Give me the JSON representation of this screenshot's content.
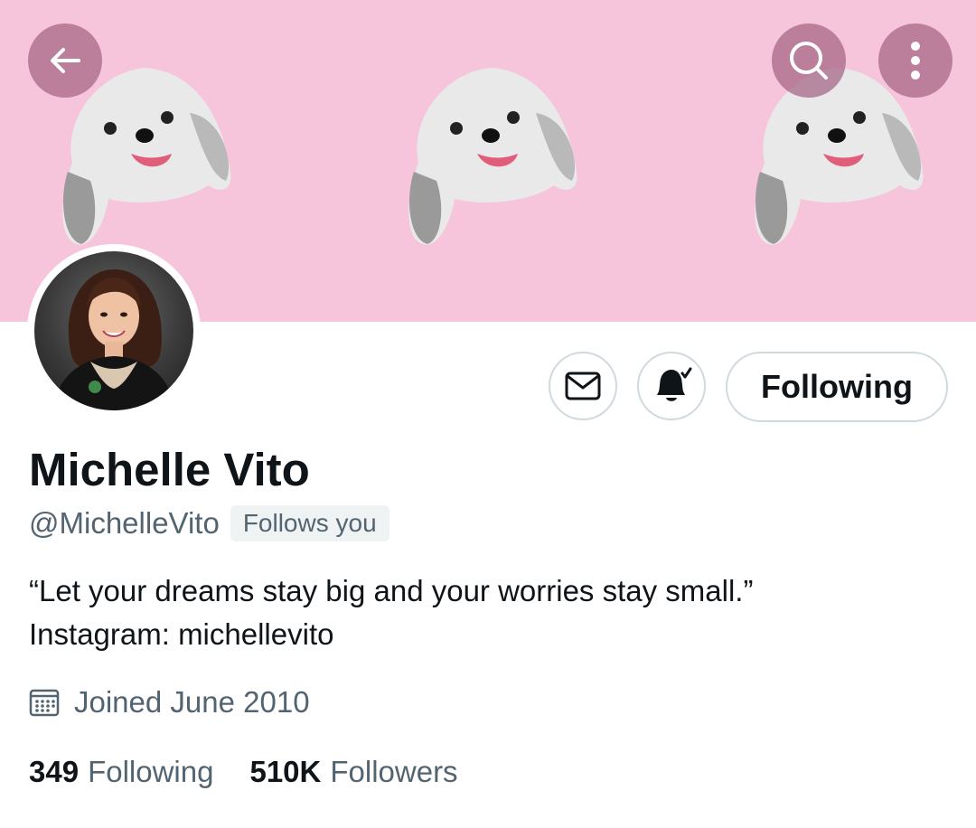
{
  "header": {
    "back_icon": "arrow-left-icon",
    "search_icon": "search-icon",
    "more_icon": "more-vertical-icon"
  },
  "banner": {
    "background_color": "#f6c5dc",
    "image_description_icon": "dog-icon"
  },
  "profile": {
    "name": "Michelle Vito",
    "handle": "@MichelleVito",
    "follows_you_label": "Follows you",
    "bio_line1": "“Let your dreams stay big and your worries stay small.”",
    "bio_line2": "Instagram: michellevito",
    "joined": "Joined June 2010",
    "joined_icon": "calendar-icon"
  },
  "actions": {
    "message_icon": "mail-icon",
    "notifications_icon": "bell-subscribed-icon",
    "following_label": "Following"
  },
  "stats": {
    "following_count": "349",
    "following_label": "Following",
    "followers_count": "510K",
    "followers_label": "Followers"
  },
  "colors": {
    "text_primary": "#0f1419",
    "text_secondary": "#536471",
    "border": "#cfd9de",
    "overlay_button": "#a46484"
  }
}
